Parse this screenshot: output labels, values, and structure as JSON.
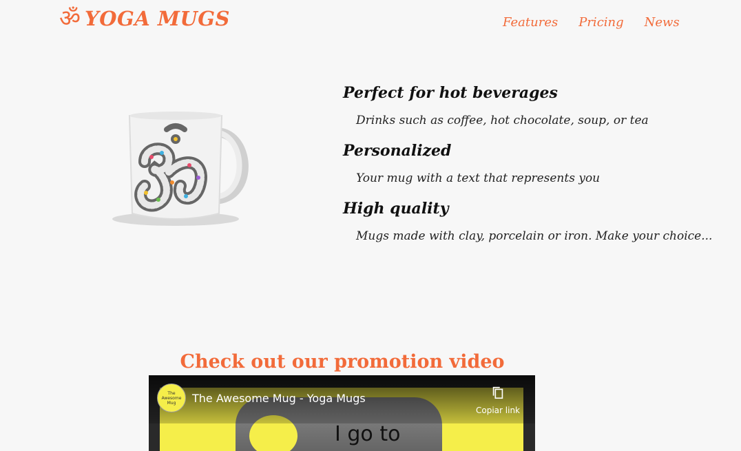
{
  "header": {
    "logo_symbol": "ॐ",
    "logo_text": "YOGA MUGS",
    "nav": [
      {
        "label": "Features"
      },
      {
        "label": "Pricing"
      },
      {
        "label": "News"
      }
    ]
  },
  "features": [
    {
      "title": "Perfect for hot beverages",
      "desc": "Drinks such as coffee, hot chocolate, soup, or tea"
    },
    {
      "title": "Personalized",
      "desc": "Your mug with a text that represents you"
    },
    {
      "title": "High quality",
      "desc": "Mugs made with clay, porcelain or iron. Make your choice..."
    }
  ],
  "promo": {
    "title": "Check out our promotion video",
    "video_title": "The Awesome Mug - Yoga Mugs",
    "channel_avatar_text": "The Awesome Mug",
    "copy_link_label": "Copiar link",
    "frame_text": "I go to"
  },
  "colors": {
    "accent": "#f26b3a",
    "background": "#f7f7f7",
    "video_yellow": "#f5ee4a"
  }
}
